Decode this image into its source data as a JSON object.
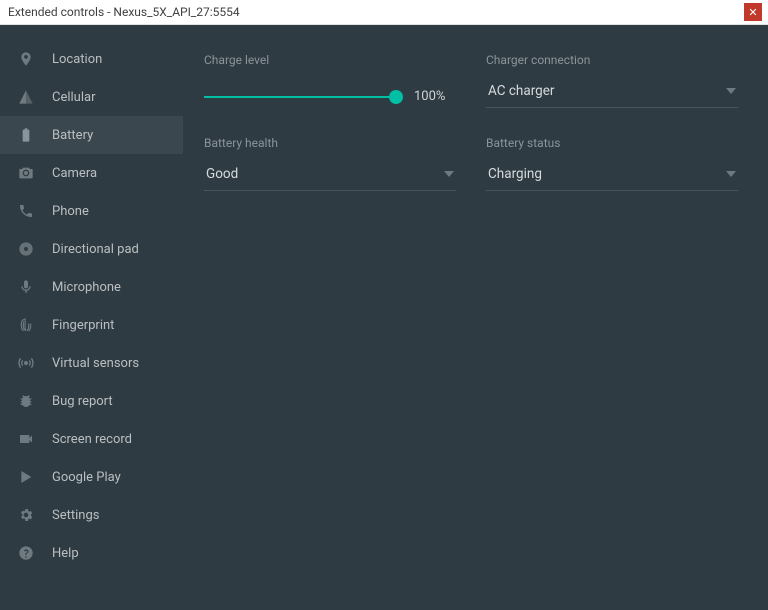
{
  "window": {
    "title": "Extended controls - Nexus_5X_API_27:5554"
  },
  "sidebar": {
    "items": [
      {
        "label": "Location"
      },
      {
        "label": "Cellular"
      },
      {
        "label": "Battery"
      },
      {
        "label": "Camera"
      },
      {
        "label": "Phone"
      },
      {
        "label": "Directional pad"
      },
      {
        "label": "Microphone"
      },
      {
        "label": "Fingerprint"
      },
      {
        "label": "Virtual sensors"
      },
      {
        "label": "Bug report"
      },
      {
        "label": "Screen record"
      },
      {
        "label": "Google Play"
      },
      {
        "label": "Settings"
      },
      {
        "label": "Help"
      }
    ],
    "active_index": 2
  },
  "battery": {
    "charge_level_label": "Charge level",
    "charge_level_value": "100%",
    "charger_connection_label": "Charger connection",
    "charger_connection_value": "AC charger",
    "health_label": "Battery health",
    "health_value": "Good",
    "status_label": "Battery status",
    "status_value": "Charging"
  },
  "colors": {
    "accent": "#00bfa5",
    "bg": "#2e3b42"
  }
}
